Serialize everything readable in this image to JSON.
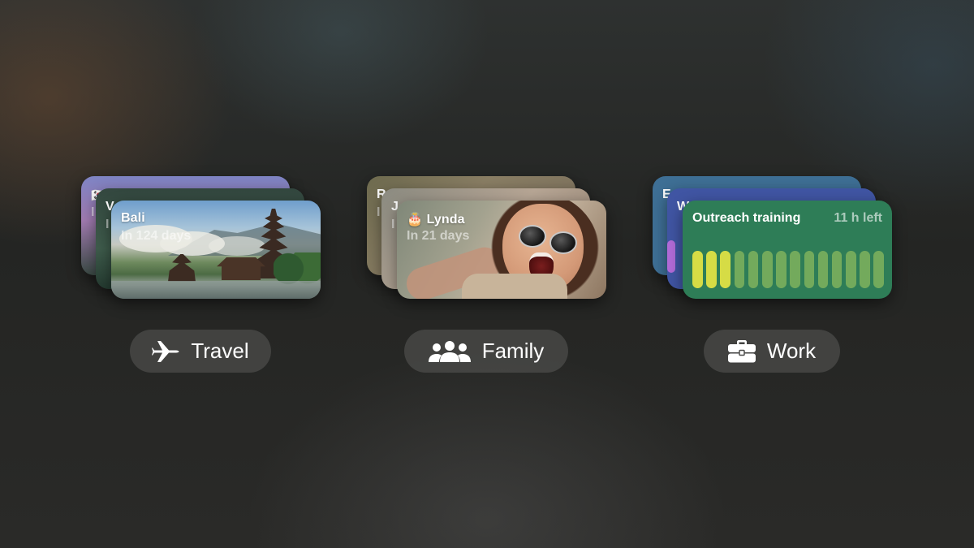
{
  "categories": {
    "travel": {
      "label": "Travel",
      "icon": "airplane-icon",
      "card": {
        "title": "Bali",
        "subtitle": "In 124 days"
      },
      "back_cards": [
        {
          "title": "🇰🇷",
          "subtitle": "I"
        },
        {
          "title": "V",
          "subtitle": "I"
        }
      ]
    },
    "family": {
      "label": "Family",
      "icon": "people-icon",
      "card": {
        "title": "🎂 Lynda",
        "subtitle": "In 21 days"
      },
      "back_cards": [
        {
          "title": "R",
          "subtitle": "I"
        },
        {
          "title": "J",
          "subtitle": "I"
        }
      ]
    },
    "work": {
      "label": "Work",
      "icon": "briefcase-icon",
      "card": {
        "title": "Outreach training",
        "time_left": "11 h left",
        "progress": {
          "completed": 3,
          "total": 14
        }
      },
      "back_cards": [
        {
          "title": "E"
        },
        {
          "title": "W"
        }
      ],
      "colors": {
        "front": "#2e7d57",
        "back1": "#3e6f95",
        "back2": "#4055a3",
        "bar_done": "#d6dc45",
        "bar_todo": "#73aa5c"
      }
    }
  }
}
